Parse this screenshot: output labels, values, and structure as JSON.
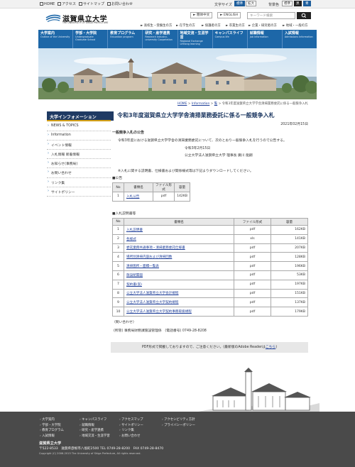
{
  "topbar": {
    "links": [
      "HOME",
      "アクセス",
      "サイトマップ",
      "お問い合わせ"
    ],
    "font_size_label": "文字サイズ",
    "font_sizes": [
      "標準",
      "拡大"
    ],
    "bg_color_label": "背景色",
    "bg_colors": [
      "標準",
      "黒",
      "青"
    ]
  },
  "header": {
    "logo_text": "滋賀県立大学",
    "logo_sub": "THE UNIVERSITY OF SHIGA PREFECTURE",
    "lang_buttons": [
      "► 簡体中文",
      "► ENGLISH"
    ],
    "search_placeholder": "キーワード検索",
    "quick_links": [
      "► 高校生・受験生の方",
      "► 在学生の方",
      "► 保護者の方",
      "► 卒業生の方",
      "► 企業・研究者の方",
      "► 地域・一般の方"
    ]
  },
  "nav": [
    {
      "label": "大学案内",
      "sub": "Outline of the University"
    },
    {
      "label": "学部・大学院",
      "sub": "Undergraduate Graduate School"
    },
    {
      "label": "教育プログラム",
      "sub": "Education program"
    },
    {
      "label": "研究・産学連携",
      "sub": "Research Industry-university Cooperation"
    },
    {
      "label": "地域交流・生涯学習",
      "sub": "Regional Exchange Lifelong learning"
    },
    {
      "label": "キャンパスライフ",
      "sub": "Campus life"
    },
    {
      "label": "就職情報",
      "sub": "Job information"
    },
    {
      "label": "入試情報",
      "sub": "Admissions Information"
    }
  ],
  "breadcrumb": {
    "home": "HOME",
    "sep1": " > ",
    "info": "Information",
    "sep2": " > ",
    "mid": "覧",
    "sep3": " > ",
    "current": "令和3年度滋賀県立大学学舎清掃業務委託に係る一般競争入札"
  },
  "sidebar": {
    "heading": "大学インフォメーション",
    "items": [
      "NEWS & TOPICS",
      "Information",
      "イベント情報",
      "入札情報 新着情報",
      "お知らせ(事務局)",
      "お問い合わせ",
      "リンク集",
      "サイトポリシー"
    ]
  },
  "main": {
    "title": "令和3年度滋賀県立大学学舎清掃業務委託に係る一般競争入札",
    "date": "2021年02月15日",
    "section1": "一般競争入札の公告",
    "body1": "令和3年度における滋賀県立大学学舎の清掃業務委託について、次のとおり一般競争入札を行うので公告する。",
    "body_date": "令和3年2月15日",
    "body_signer": "公立大学法人滋賀県立大学 理事長 廣川 能嗣",
    "body2": "※入札に関する説明書、仕様書および関係様式等は下記よりダウンロードしてください。",
    "notice_head": "■公告",
    "table1": {
      "headers": [
        "No",
        "書類名",
        "ファイル形式",
        "容量"
      ],
      "rows": [
        {
          "no": "1",
          "name": "入札公告",
          "format": "pdf",
          "size": "142KB"
        }
      ]
    },
    "desc_head": "■入札説明書等",
    "table2": {
      "headers": [
        "No",
        "書類名",
        "ファイル形式",
        "容量"
      ],
      "rows": [
        {
          "no": "1",
          "name": "入札説明書",
          "format": "pdf",
          "size": "162KB"
        },
        {
          "no": "2",
          "name": "各様式",
          "format": "xls",
          "size": "141KB"
        },
        {
          "no": "3",
          "name": "委託業務共通事項・清掃業務委託仕様書",
          "format": "pdf",
          "size": "207KB"
        },
        {
          "no": "4",
          "name": "場所別清掃内容および清掃回数",
          "format": "pdf",
          "size": "128KB"
        },
        {
          "no": "5",
          "name": "清掃箇所・面積一覧表",
          "format": "pdf",
          "size": "196KB"
        },
        {
          "no": "6",
          "name": "施設配置図",
          "format": "pdf",
          "size": "53KB"
        },
        {
          "no": "7",
          "name": "契約書(案)",
          "format": "pdf",
          "size": "197KB"
        },
        {
          "no": "8",
          "name": "公立大学法人滋賀県立大学会計規程",
          "format": "pdf",
          "size": "151KB"
        },
        {
          "no": "9",
          "name": "公立大学法人滋賀県立大学契約規程",
          "format": "pdf",
          "size": "137KB"
        },
        {
          "no": "10",
          "name": "公立大学法人滋賀県立大学契約事務取扱規程",
          "format": "pdf",
          "size": "179KB"
        }
      ]
    },
    "contact_head": "〈問い合わせ〉",
    "contact": "(所管) 事務局財務課施設管理係　(電話番号) 0749-28-8208",
    "pdf_note": "PDF形式で掲載しておりますので、ご注意ください。(最新版のAdobe Readerは",
    "pdf_link": "こちら",
    "pdf_tail": ")"
  },
  "footer": {
    "col1": [
      "大学案内",
      "学部・大学院",
      "教育プログラム",
      "入試情報"
    ],
    "col2": [
      "キャンパスライフ",
      "就職情報",
      "研究・産学連携",
      "地域交流・生涯学習"
    ],
    "col3": [
      "アクセスマップ",
      "サイトポリシー",
      "リンク集",
      "お問い合わせ"
    ],
    "col4": [
      "アクセシビリティ方針",
      "プライバシーポリシー"
    ],
    "name": "滋賀県立大学",
    "address": "〒522-8533　滋賀県彦根市八坂町2500 TEL 0749-28-8200　FAX 0749-28-8470",
    "copyright": "Copyright (C) 2006-2015 The University of Shiga Prefecture, All rights reserved."
  }
}
